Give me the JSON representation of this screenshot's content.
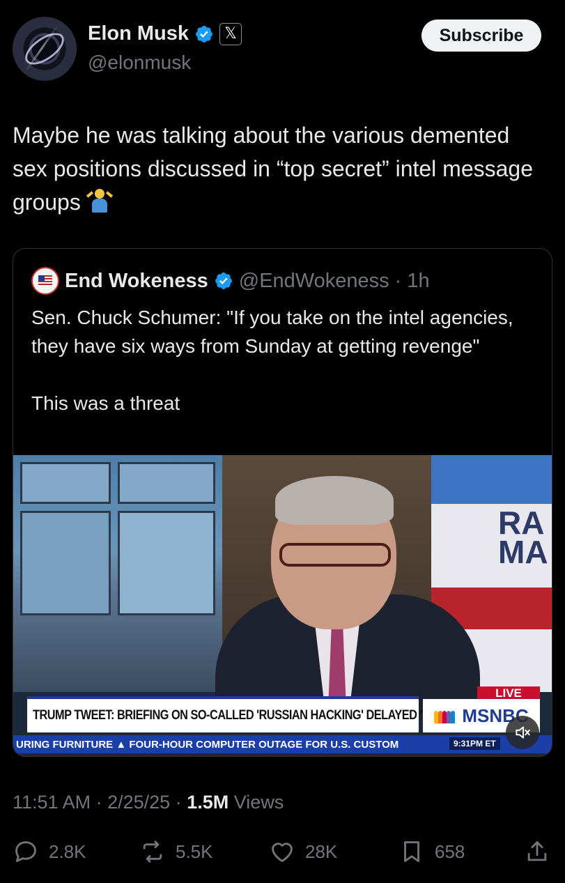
{
  "author": {
    "name": "Elon Musk",
    "handle": "@elonmusk",
    "verified_color": "#1d9bf0",
    "badge_icon": "x-logo-icon"
  },
  "subscribe_label": "Subscribe",
  "tweet_text": "Maybe he was talking about the various demented sex positions discussed in “top secret” intel message groups",
  "tweet_emoji": "person-shrugging-emoji",
  "quote": {
    "name": "End Wokeness",
    "handle": "@EndWokeness",
    "separator": "·",
    "age": "1h",
    "text": "Sen. Chuck Schumer: \"If you take on the intel agencies, they have six ways from Sunday at getting revenge\"\n\nThis was a threat",
    "video": {
      "chyron": "TRUMP TWEET: BRIEFING ON SO-CALLED 'RUSSIAN HACKING' DELAYED 'TIL FRI.",
      "live_badge": "LIVE",
      "network": "MSNBC",
      "show_text": "RA\nMA",
      "ticker": "URING FURNITURE  ▲  FOUR-HOUR COMPUTER OUTAGE FOR U.S. CUSTOM",
      "ticker_time": "9:31PM ET",
      "muted": true
    }
  },
  "meta": {
    "time": "11:51 AM",
    "date": "2/25/25",
    "views_count": "1.5M",
    "views_label": "Views",
    "dot": "·"
  },
  "actions": {
    "replies": "2.8K",
    "reposts": "5.5K",
    "likes": "28K",
    "bookmarks": "658"
  },
  "colors": {
    "background": "#000000",
    "text": "#e7e9ea",
    "muted": "#71767b",
    "border": "#2f3336",
    "verified": "#1d9bf0"
  }
}
